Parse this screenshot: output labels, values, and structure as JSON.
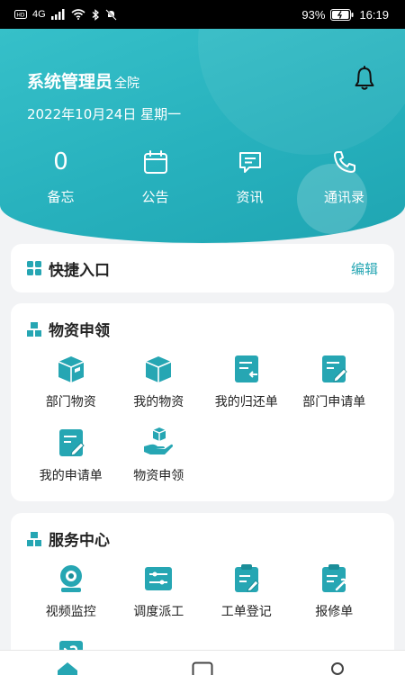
{
  "status_bar": {
    "network": "4G",
    "battery": "93%",
    "time": "16:19"
  },
  "header": {
    "user_name": "系统管理员",
    "user_scope": "全院",
    "date": "2022年10月24日 星期一"
  },
  "quick_stats": [
    {
      "value": "0",
      "label": "备忘"
    },
    {
      "label": "公告",
      "icon": "calendar-icon"
    },
    {
      "label": "资讯",
      "icon": "message-icon"
    },
    {
      "label": "通讯录",
      "icon": "phone-icon"
    }
  ],
  "shortcut": {
    "title": "快捷入口",
    "edit_label": "编辑"
  },
  "materials": {
    "title": "物资申领",
    "items": [
      {
        "label": "部门物资",
        "icon": "box-icon"
      },
      {
        "label": "我的物资",
        "icon": "box-icon"
      },
      {
        "label": "我的归还单",
        "icon": "return-form-icon"
      },
      {
        "label": "部门申请单",
        "icon": "edit-form-icon"
      },
      {
        "label": "我的申请单",
        "icon": "edit-form-icon"
      },
      {
        "label": "物资申领",
        "icon": "hand-box-icon"
      }
    ]
  },
  "service": {
    "title": "服务中心",
    "items": [
      {
        "label": "视频监控",
        "icon": "camera-icon"
      },
      {
        "label": "调度派工",
        "icon": "dispatch-icon"
      },
      {
        "label": "工单登记",
        "icon": "clipboard-icon"
      },
      {
        "label": "报修单",
        "icon": "repair-form-icon"
      }
    ]
  },
  "colors": {
    "accent": "#26a6b3",
    "accent_dark": "#1b8e99"
  }
}
